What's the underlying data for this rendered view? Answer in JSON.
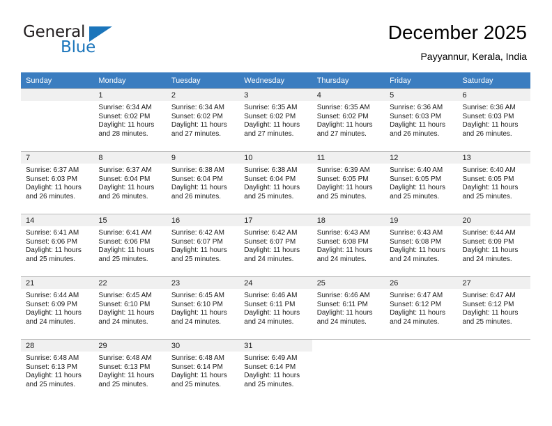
{
  "brand": {
    "name_part1": "General",
    "name_part2": "Blue",
    "triangle_icon": "triangle-logo-icon",
    "accent_color": "#1b75bb"
  },
  "header": {
    "title": "December 2025",
    "subtitle": "Payyannur, Kerala, India"
  },
  "calendar": {
    "header_bg": "#3b7dc0",
    "day_bar_bg": "#f0f0f0",
    "weekday_headers": [
      "Sunday",
      "Monday",
      "Tuesday",
      "Wednesday",
      "Thursday",
      "Friday",
      "Saturday"
    ],
    "weeks": [
      [
        {
          "day": "",
          "sunrise": "",
          "sunset": "",
          "daylight1": "",
          "daylight2": "",
          "blank": true
        },
        {
          "day": "1",
          "sunrise": "Sunrise: 6:34 AM",
          "sunset": "Sunset: 6:02 PM",
          "daylight1": "Daylight: 11 hours",
          "daylight2": "and 28 minutes."
        },
        {
          "day": "2",
          "sunrise": "Sunrise: 6:34 AM",
          "sunset": "Sunset: 6:02 PM",
          "daylight1": "Daylight: 11 hours",
          "daylight2": "and 27 minutes."
        },
        {
          "day": "3",
          "sunrise": "Sunrise: 6:35 AM",
          "sunset": "Sunset: 6:02 PM",
          "daylight1": "Daylight: 11 hours",
          "daylight2": "and 27 minutes."
        },
        {
          "day": "4",
          "sunrise": "Sunrise: 6:35 AM",
          "sunset": "Sunset: 6:02 PM",
          "daylight1": "Daylight: 11 hours",
          "daylight2": "and 27 minutes."
        },
        {
          "day": "5",
          "sunrise": "Sunrise: 6:36 AM",
          "sunset": "Sunset: 6:03 PM",
          "daylight1": "Daylight: 11 hours",
          "daylight2": "and 26 minutes."
        },
        {
          "day": "6",
          "sunrise": "Sunrise: 6:36 AM",
          "sunset": "Sunset: 6:03 PM",
          "daylight1": "Daylight: 11 hours",
          "daylight2": "and 26 minutes."
        }
      ],
      [
        {
          "day": "7",
          "sunrise": "Sunrise: 6:37 AM",
          "sunset": "Sunset: 6:03 PM",
          "daylight1": "Daylight: 11 hours",
          "daylight2": "and 26 minutes."
        },
        {
          "day": "8",
          "sunrise": "Sunrise: 6:37 AM",
          "sunset": "Sunset: 6:04 PM",
          "daylight1": "Daylight: 11 hours",
          "daylight2": "and 26 minutes."
        },
        {
          "day": "9",
          "sunrise": "Sunrise: 6:38 AM",
          "sunset": "Sunset: 6:04 PM",
          "daylight1": "Daylight: 11 hours",
          "daylight2": "and 26 minutes."
        },
        {
          "day": "10",
          "sunrise": "Sunrise: 6:38 AM",
          "sunset": "Sunset: 6:04 PM",
          "daylight1": "Daylight: 11 hours",
          "daylight2": "and 25 minutes."
        },
        {
          "day": "11",
          "sunrise": "Sunrise: 6:39 AM",
          "sunset": "Sunset: 6:05 PM",
          "daylight1": "Daylight: 11 hours",
          "daylight2": "and 25 minutes."
        },
        {
          "day": "12",
          "sunrise": "Sunrise: 6:40 AM",
          "sunset": "Sunset: 6:05 PM",
          "daylight1": "Daylight: 11 hours",
          "daylight2": "and 25 minutes."
        },
        {
          "day": "13",
          "sunrise": "Sunrise: 6:40 AM",
          "sunset": "Sunset: 6:05 PM",
          "daylight1": "Daylight: 11 hours",
          "daylight2": "and 25 minutes."
        }
      ],
      [
        {
          "day": "14",
          "sunrise": "Sunrise: 6:41 AM",
          "sunset": "Sunset: 6:06 PM",
          "daylight1": "Daylight: 11 hours",
          "daylight2": "and 25 minutes."
        },
        {
          "day": "15",
          "sunrise": "Sunrise: 6:41 AM",
          "sunset": "Sunset: 6:06 PM",
          "daylight1": "Daylight: 11 hours",
          "daylight2": "and 25 minutes."
        },
        {
          "day": "16",
          "sunrise": "Sunrise: 6:42 AM",
          "sunset": "Sunset: 6:07 PM",
          "daylight1": "Daylight: 11 hours",
          "daylight2": "and 25 minutes."
        },
        {
          "day": "17",
          "sunrise": "Sunrise: 6:42 AM",
          "sunset": "Sunset: 6:07 PM",
          "daylight1": "Daylight: 11 hours",
          "daylight2": "and 24 minutes."
        },
        {
          "day": "18",
          "sunrise": "Sunrise: 6:43 AM",
          "sunset": "Sunset: 6:08 PM",
          "daylight1": "Daylight: 11 hours",
          "daylight2": "and 24 minutes."
        },
        {
          "day": "19",
          "sunrise": "Sunrise: 6:43 AM",
          "sunset": "Sunset: 6:08 PM",
          "daylight1": "Daylight: 11 hours",
          "daylight2": "and 24 minutes."
        },
        {
          "day": "20",
          "sunrise": "Sunrise: 6:44 AM",
          "sunset": "Sunset: 6:09 PM",
          "daylight1": "Daylight: 11 hours",
          "daylight2": "and 24 minutes."
        }
      ],
      [
        {
          "day": "21",
          "sunrise": "Sunrise: 6:44 AM",
          "sunset": "Sunset: 6:09 PM",
          "daylight1": "Daylight: 11 hours",
          "daylight2": "and 24 minutes."
        },
        {
          "day": "22",
          "sunrise": "Sunrise: 6:45 AM",
          "sunset": "Sunset: 6:10 PM",
          "daylight1": "Daylight: 11 hours",
          "daylight2": "and 24 minutes."
        },
        {
          "day": "23",
          "sunrise": "Sunrise: 6:45 AM",
          "sunset": "Sunset: 6:10 PM",
          "daylight1": "Daylight: 11 hours",
          "daylight2": "and 24 minutes."
        },
        {
          "day": "24",
          "sunrise": "Sunrise: 6:46 AM",
          "sunset": "Sunset: 6:11 PM",
          "daylight1": "Daylight: 11 hours",
          "daylight2": "and 24 minutes."
        },
        {
          "day": "25",
          "sunrise": "Sunrise: 6:46 AM",
          "sunset": "Sunset: 6:11 PM",
          "daylight1": "Daylight: 11 hours",
          "daylight2": "and 24 minutes."
        },
        {
          "day": "26",
          "sunrise": "Sunrise: 6:47 AM",
          "sunset": "Sunset: 6:12 PM",
          "daylight1": "Daylight: 11 hours",
          "daylight2": "and 24 minutes."
        },
        {
          "day": "27",
          "sunrise": "Sunrise: 6:47 AM",
          "sunset": "Sunset: 6:12 PM",
          "daylight1": "Daylight: 11 hours",
          "daylight2": "and 25 minutes."
        }
      ],
      [
        {
          "day": "28",
          "sunrise": "Sunrise: 6:48 AM",
          "sunset": "Sunset: 6:13 PM",
          "daylight1": "Daylight: 11 hours",
          "daylight2": "and 25 minutes."
        },
        {
          "day": "29",
          "sunrise": "Sunrise: 6:48 AM",
          "sunset": "Sunset: 6:13 PM",
          "daylight1": "Daylight: 11 hours",
          "daylight2": "and 25 minutes."
        },
        {
          "day": "30",
          "sunrise": "Sunrise: 6:48 AM",
          "sunset": "Sunset: 6:14 PM",
          "daylight1": "Daylight: 11 hours",
          "daylight2": "and 25 minutes."
        },
        {
          "day": "31",
          "sunrise": "Sunrise: 6:49 AM",
          "sunset": "Sunset: 6:14 PM",
          "daylight1": "Daylight: 11 hours",
          "daylight2": "and 25 minutes."
        },
        {
          "day": "",
          "sunrise": "",
          "sunset": "",
          "daylight1": "",
          "daylight2": "",
          "void": true
        },
        {
          "day": "",
          "sunrise": "",
          "sunset": "",
          "daylight1": "",
          "daylight2": "",
          "void": true
        },
        {
          "day": "",
          "sunrise": "",
          "sunset": "",
          "daylight1": "",
          "daylight2": "",
          "void": true
        }
      ]
    ]
  }
}
